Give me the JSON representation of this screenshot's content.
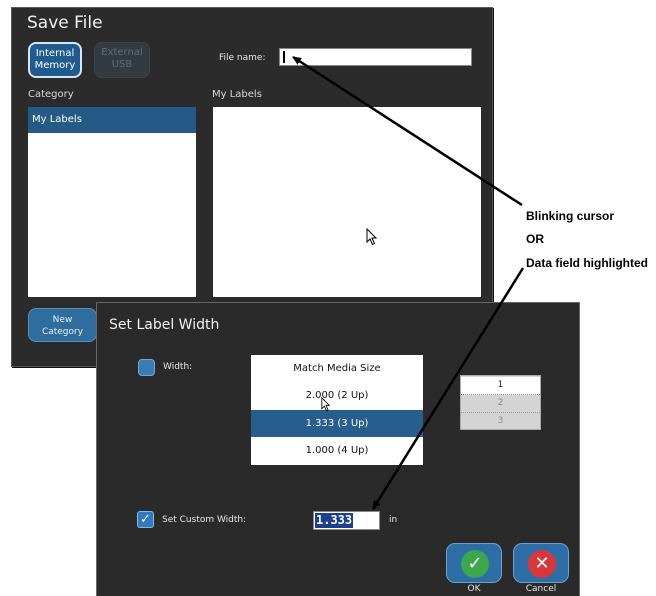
{
  "save_file": {
    "title": "Save File",
    "source_buttons": [
      {
        "label_line1": "Internal",
        "label_line2": "Memory",
        "active": true
      },
      {
        "label_line1": "External",
        "label_line2": "USB",
        "active": false
      }
    ],
    "file_name_label": "File name:",
    "file_name_value": "",
    "category_header": "Category",
    "categories": [
      "My Labels"
    ],
    "selected_category": "My Labels",
    "list_header": "My Labels",
    "new_category_line1": "New",
    "new_category_line2": "Category"
  },
  "set_label_width": {
    "title": "Set Label Width",
    "width_label": "Width:",
    "width_options": [
      "Match Media Size",
      "2.000 (2 Up)",
      "1.333 (3 Up)",
      "1.000 (4 Up)"
    ],
    "selected_width": "1.333 (3 Up)",
    "count_options": [
      "1",
      "2",
      "3"
    ],
    "custom_width_label": "Set Custom Width:",
    "custom_width_checked": true,
    "custom_width_value": "1.333",
    "unit": "in",
    "ok_label": "OK",
    "cancel_label": "Cancel"
  },
  "annotations": {
    "line1": "Blinking cursor",
    "line2": "OR",
    "line3": "Data field highlighted"
  },
  "icons": {
    "ok": "checkmark-icon",
    "cancel": "close-icon",
    "pointer": "mouse-pointer-icon"
  },
  "colors": {
    "dialog_bg": "#2b2b2b",
    "accent_blue": "#255a87",
    "ok_green": "#3aa84a",
    "cancel_red": "#d9363a",
    "highlight": "#1e3f8c"
  }
}
